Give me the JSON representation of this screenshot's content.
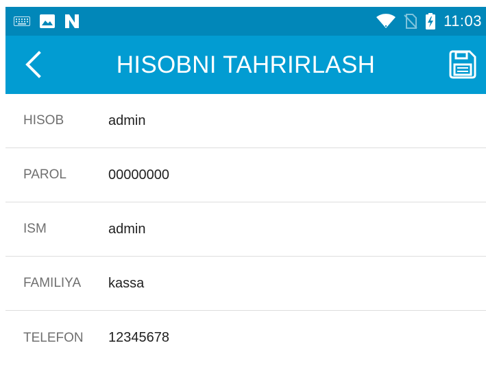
{
  "status_bar": {
    "icons": [
      "keyboard-icon",
      "image-icon",
      "n-notification-icon"
    ],
    "right_icons": [
      "wifi-icon",
      "no-sim-icon",
      "battery-charging-icon"
    ],
    "time": "11:03"
  },
  "app_bar": {
    "title": "HISOBNI TAHRIRLASH",
    "back_icon": "back-arrow-icon",
    "save_icon": "save-icon"
  },
  "fields": [
    {
      "label": "HISOB",
      "value": "admin"
    },
    {
      "label": "PAROL",
      "value": "00000000"
    },
    {
      "label": "ISM",
      "value": "admin"
    },
    {
      "label": "FAMILIYA",
      "value": "kassa"
    },
    {
      "label": "TELEFON",
      "value": "12345678"
    }
  ],
  "colors": {
    "status_bar": "#0187b9",
    "app_bar": "#029cd2",
    "label_text": "#6f6f6f",
    "value_text": "#1f1f1f",
    "divider": "#dddddd"
  }
}
